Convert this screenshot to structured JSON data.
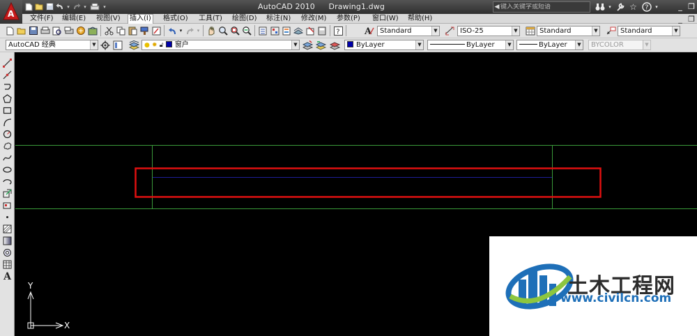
{
  "window": {
    "title_app": "AutoCAD 2010",
    "title_file": "Drawing1.dwg",
    "search_placeholder": "键入关键字或短语",
    "logo_letter": "A"
  },
  "quick_access": [
    "new-icon",
    "open-icon",
    "save-icon",
    "undo-icon",
    "redo-icon",
    "plot-icon"
  ],
  "menu": {
    "items": [
      "文件(F)",
      "编辑(E)",
      "视图(V)",
      "插入(I)",
      "格式(O)",
      "工具(T)",
      "绘图(D)",
      "标注(N)",
      "修改(M)",
      "参数(P)",
      "窗口(W)",
      "帮助(H)"
    ],
    "active_index": 3
  },
  "toolbar1": {
    "text_style": "Standard",
    "dim_style": "ISO-25",
    "table_style": "Standard",
    "multileader_style": "Standard"
  },
  "toolbar2": {
    "workspace": "AutoCAD 经典",
    "layer": "窗户",
    "layer_color": "#0000aa",
    "color": "ByLayer",
    "color_swatch": "#0000aa",
    "linetype": "ByLayer",
    "lineweight": "ByLayer",
    "plot_style": "BYCOLOR"
  },
  "ucs": {
    "x_label": "X",
    "y_label": "Y"
  },
  "drawing": {
    "green_color": "#3a9a3a",
    "blue_color": "#1e1e9a",
    "highlight_color": "#e01010"
  },
  "watermark": {
    "title": "土木工程网",
    "url": "www.civilcn.com",
    "brand_blue": "#1e6fb8",
    "brand_green": "#8dc63f"
  }
}
